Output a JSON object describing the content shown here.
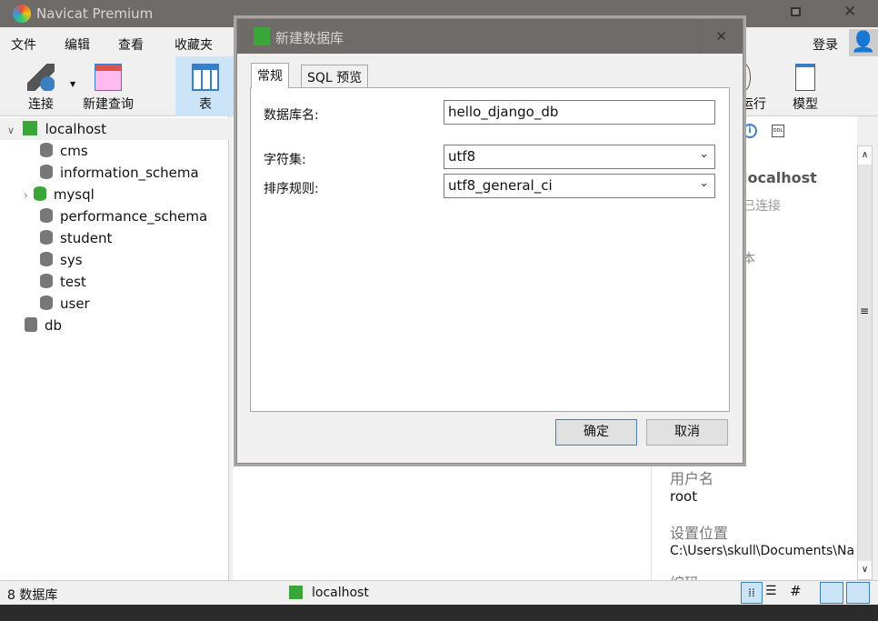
{
  "app": {
    "title": "Navicat Premium"
  },
  "menu": [
    "文件",
    "编辑",
    "查看",
    "收藏夹"
  ],
  "login": "登录",
  "toolbar": {
    "connect": "连接",
    "new_query": "新建查询",
    "table": "表",
    "run": "运行",
    "model": "模型"
  },
  "tree": {
    "connection": "localhost",
    "databases": [
      "cms",
      "information_schema",
      "mysql",
      "performance_schema",
      "student",
      "sys",
      "test",
      "user"
    ],
    "other": "db"
  },
  "info": {
    "name": "localhost",
    "state": "已连接",
    "partial": "本",
    "user_label": "用户名",
    "user": "root",
    "location_label": "设置位置",
    "location": "C:\\Users\\skull\\Documents\\Na",
    "partial2": "编码"
  },
  "status": {
    "count": "8 数据库",
    "connection": "localhost"
  },
  "dialog": {
    "title": "新建数据库",
    "tabs": [
      "常规",
      "SQL 预览"
    ],
    "fields": {
      "name_label": "数据库名:",
      "name_value": "hello_django_db",
      "charset_label": "字符集:",
      "charset_value": "utf8",
      "collation_label": "排序规则:",
      "collation_value": "utf8_general_ci"
    },
    "ok": "确定",
    "cancel": "取消"
  },
  "colors": {
    "titlebar": "#6f6b68",
    "selected": "#cce4f7",
    "green": "#3aa63a"
  }
}
